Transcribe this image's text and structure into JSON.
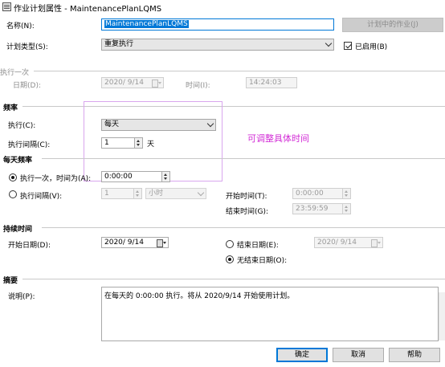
{
  "window": {
    "title": "作业计划属性 - MaintenancePlanLQMS"
  },
  "name_row": {
    "label": "名称(N):",
    "value": "MaintenancePlanLQMS",
    "jobs_button": "计划中的作业(J)"
  },
  "type_row": {
    "label": "计划类型(S):",
    "value": "重复执行",
    "enabled_label": "已启用(B)",
    "enabled_checked": true
  },
  "once": {
    "section": "执行一次",
    "date_label": "日期(D):",
    "date_value": "2020/ 9/14",
    "time_label": "时间(I):",
    "time_value": "14:24:03"
  },
  "frequency": {
    "section": "频率",
    "occurs_label": "执行(C):",
    "occurs_value": "每天",
    "interval_label": "执行间隔(C):",
    "interval_value": "1",
    "interval_unit": "天"
  },
  "annotation": "可调整具体时间",
  "daily": {
    "section": "每天频率",
    "once_at_label": "执行一次，时间为(A):",
    "once_at_value": "0:00:00",
    "once_at_selected": true,
    "every_label": "执行间隔(V):",
    "every_value": "1",
    "every_unit": "小时",
    "start_label": "开始时间(T):",
    "start_value": "0:00:00",
    "end_label": "结束时间(G):",
    "end_value": "23:59:59"
  },
  "duration": {
    "section": "持续时间",
    "start_label": "开始日期(D):",
    "start_value": "2020/ 9/14",
    "end_label": "结束日期(E):",
    "end_value": "2020/ 9/14",
    "noend_label": "无结束日期(O):",
    "noend_selected": true
  },
  "summary": {
    "section": "摘要",
    "desc_label": "说明(P):",
    "desc_value": "在每天的 0:00:00 执行。将从 2020/9/14 开始使用计划。"
  },
  "buttons": {
    "ok": "确定",
    "cancel": "取消",
    "help": "帮助"
  },
  "colors": {
    "accent": "#0078d7",
    "annotation": "#d22bd6",
    "annotation_box": "#d9a6ee"
  }
}
